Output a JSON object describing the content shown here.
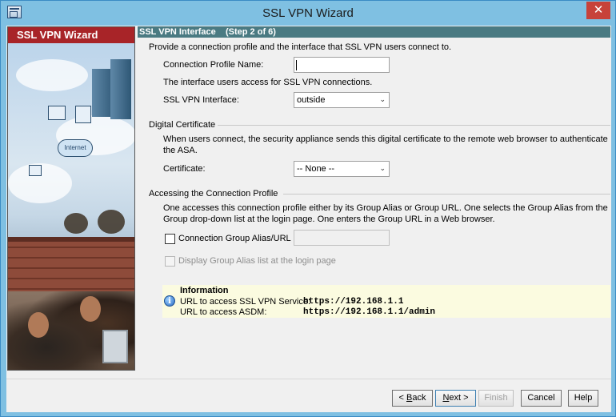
{
  "window": {
    "title": "SSL VPN Wizard",
    "close_glyph": "✕",
    "icon": "wizard-app-icon"
  },
  "side_panel": {
    "header": "SSL VPN Wizard",
    "header_color": "#a82428",
    "internet_label": "Internet"
  },
  "step": {
    "title": "SSL VPN Interface    (Step 2 of 6)"
  },
  "intro": "Provide a connection profile and the interface that SSL VPN users connect to.",
  "profile": {
    "label": "Connection Profile Name:",
    "value": ""
  },
  "interface_note": "The interface users access for SSL VPN connections.",
  "interface": {
    "label": "SSL VPN Interface:",
    "selected": "outside"
  },
  "certificate_group": {
    "title": "Digital Certificate",
    "description": "When users connect, the security appliance sends this digital certificate to the remote web browser to authenticate the ASA.",
    "label": "Certificate:",
    "selected": "-- None --"
  },
  "access_group": {
    "title": "Accessing the Connection Profile",
    "description": "One accesses this connection profile either by its Group Alias or Group URL. One selects the Group Alias from the Group drop-down list at the login page. One enters the Group URL in a Web browser.",
    "alias_checkbox_label": "Connection Group Alias/URL",
    "alias_value": "",
    "display_checkbox_label": "Display Group Alias list at the login page"
  },
  "information": {
    "title": "Information",
    "vpn_label": "URL to access SSL VPN Service:",
    "vpn_url": "https://192.168.1.1",
    "asdm_label": "URL to access ASDM:",
    "asdm_url": "https://192.168.1.1/admin",
    "icon_glyph": "i"
  },
  "buttons": {
    "back_prefix": "< ",
    "back_key": "B",
    "back_rest": "ack",
    "next_key": "N",
    "next_rest": "ext >",
    "finish": "Finish",
    "cancel": "Cancel",
    "help": "Help"
  },
  "select_arrow": "⌄"
}
